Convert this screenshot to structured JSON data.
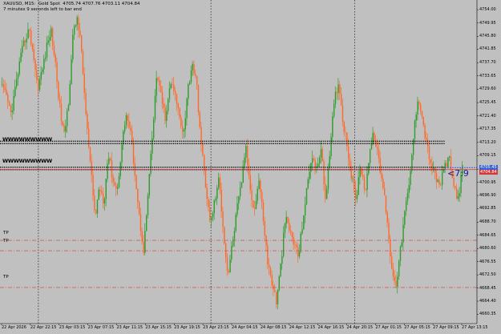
{
  "header": {
    "line1": "XAUUSD, M15:  Gold Spot  4705.74 4707.76 4703.11 4704.84",
    "line2": "7 minutes 9 seconds left to bar end"
  },
  "countdown": "<7:9",
  "level_labels": [
    "TP",
    "TP",
    "TP"
  ],
  "y_axis": {
    "labels": [
      "4754.00",
      "4749.95",
      "4745.80",
      "4741.85",
      "4737.70",
      "4733.65",
      "4729.60",
      "4725.45",
      "4721.40",
      "4717.35",
      "4713.20",
      "4709.15",
      "4705.00",
      "4700.95",
      "4696.90",
      "4692.85",
      "4688.70",
      "4684.65",
      "4680.60",
      "4676.55",
      "4672.50",
      "4668.45",
      "4664.40",
      "4660.35"
    ],
    "current_price": "4705.45",
    "current_price_2": "4704.84"
  },
  "x_axis": {
    "labels": [
      "22 Apr 2026",
      "22 Apr 22:15",
      "23 Apr 03:15",
      "23 Apr 07:15",
      "23 Apr 11:15",
      "23 Apr 15:15",
      "23 Apr 19:15",
      "23 Apr 23:15",
      "24 Apr 04:15",
      "24 Apr 08:15",
      "24 Apr 12:15",
      "24 Apr 16:15",
      "24 Apr 20:15",
      "27 Apr 01:15",
      "27 Apr 05:15",
      "27 Apr 09:15",
      "27 Apr 13:15"
    ]
  },
  "colors": {
    "background": "#c0c0c0",
    "bull": "#2e9e2e",
    "bear": "#ff6a2a",
    "grid_dotted": "#000000",
    "level_red": "#d23a3a",
    "ask_line": "#3a5fd0"
  },
  "chart_data": {
    "type": "candlestick",
    "symbol": "XAUUSD",
    "timeframe": "M15",
    "open": 4705.74,
    "high": 4707.76,
    "low": 4703.11,
    "close": 4704.84,
    "ylim": [
      4658.0,
      4756.0
    ],
    "path_prices": [
      4730,
      4727,
      4722,
      4730,
      4738,
      4744,
      4748,
      4741,
      4730,
      4735,
      4742,
      4748,
      4738,
      4724,
      4715,
      4726,
      4746,
      4752,
      4740,
      4720,
      4705,
      4690,
      4700,
      4695,
      4710,
      4702,
      4698,
      4712,
      4722,
      4716,
      4704,
      4690,
      4680,
      4698,
      4716,
      4735,
      4726,
      4720,
      4732,
      4728,
      4722,
      4716,
      4730,
      4738,
      4730,
      4712,
      4700,
      4688,
      4695,
      4702,
      4686,
      4672,
      4682,
      4692,
      4700,
      4712,
      4700,
      4692,
      4702,
      4690,
      4676,
      4670,
      4664,
      4676,
      4690,
      4686,
      4682,
      4678,
      4690,
      4700,
      4710,
      4704,
      4712,
      4696,
      4708,
      4726,
      4732,
      4720,
      4712,
      4702,
      4696,
      4706,
      4698,
      4710,
      4716,
      4708,
      4700,
      4690,
      4674,
      4670,
      4680,
      4692,
      4700,
      4716,
      4728,
      4720,
      4712,
      4706,
      4702,
      4700,
      4706,
      4708,
      4700,
      4696,
      4705
    ],
    "levels": [
      {
        "name": "resistance",
        "price": 4713.2,
        "style": "dotted-black"
      },
      {
        "name": "support",
        "price": 4705.2,
        "style": "dotted-black"
      },
      {
        "name": "tp_1",
        "price": 4683.1,
        "style": "dashdot-red"
      },
      {
        "name": "tp_2",
        "price": 4679.9,
        "style": "dashdot-red"
      },
      {
        "name": "tp_3",
        "price": 4668.6,
        "style": "dashdot-red"
      }
    ],
    "period_separators": [
      "22 Apr 22:15",
      "23 Apr 23:15",
      "24 Apr 20:15"
    ]
  }
}
